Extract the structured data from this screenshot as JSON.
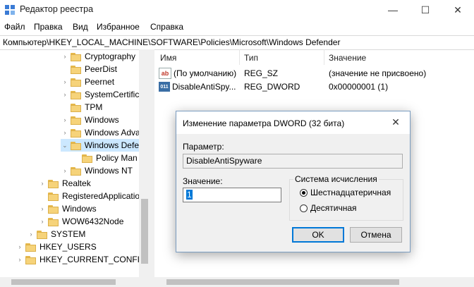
{
  "window": {
    "title": "Редактор реестра",
    "minimize": "—",
    "maximize": "☐",
    "close": "✕"
  },
  "menu": [
    "Файл",
    "Правка",
    "Вид",
    "Избранное",
    "Справка"
  ],
  "address": "Компьютер\\HKEY_LOCAL_MACHINE\\SOFTWARE\\Policies\\Microsoft\\Windows Defender",
  "tree": [
    {
      "label": "Cryptography",
      "expander": "›"
    },
    {
      "label": "PeerDist",
      "expander": ""
    },
    {
      "label": "Peernet",
      "expander": "›"
    },
    {
      "label": "SystemCertific",
      "expander": "›"
    },
    {
      "label": "TPM",
      "expander": ""
    },
    {
      "label": "Windows",
      "expander": "›"
    },
    {
      "label": "Windows Adva",
      "expander": "›"
    },
    {
      "label": "Windows Defe",
      "expander": "⌄",
      "selected": true
    },
    {
      "label": "Policy Man",
      "expander": ""
    },
    {
      "label": "Windows NT",
      "expander": "›"
    },
    {
      "label": "Realtek",
      "expander": "›"
    },
    {
      "label": "RegisteredApplicatio",
      "expander": ""
    },
    {
      "label": "Windows",
      "expander": "›"
    },
    {
      "label": "WOW6432Node",
      "expander": "›"
    },
    {
      "label": "SYSTEM",
      "expander": "›"
    },
    {
      "label": "HKEY_USERS",
      "expander": "›"
    },
    {
      "label": "HKEY_CURRENT_CONFIG",
      "expander": "›"
    }
  ],
  "columns": {
    "name": "Имя",
    "type": "Тип",
    "value": "Значение"
  },
  "rows": [
    {
      "icon": "string-value-icon",
      "glyph": "ab",
      "name": "(По умолчанию)",
      "type": "REG_SZ",
      "value": "(значение не присвоено)"
    },
    {
      "icon": "dword-value-icon",
      "glyph": "011",
      "name": "DisableAntiSpy...",
      "type": "REG_DWORD",
      "value": "0x00000001 (1)"
    }
  ],
  "dialog": {
    "title": "Изменение параметра DWORD (32 бита)",
    "close": "✕",
    "name_label": "Параметр:",
    "name_value": "DisableAntiSpyware",
    "value_label": "Значение:",
    "value": "1",
    "base_label": "Система исчисления",
    "hex_label": "Шестнадцатеричная",
    "dec_label": "Десятичная",
    "hex_selected": true,
    "ok": "OK",
    "cancel": "Отмена"
  }
}
